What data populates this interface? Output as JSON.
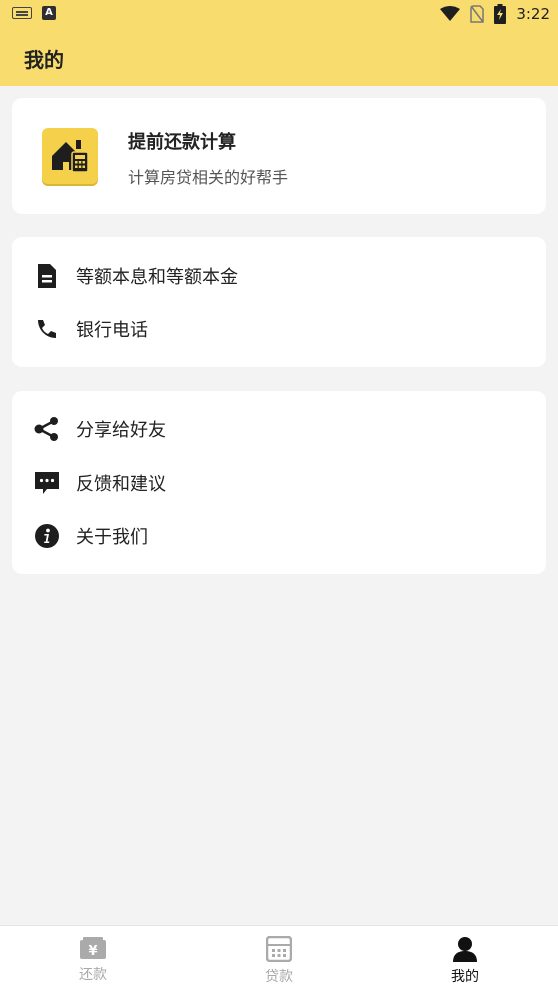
{
  "status_bar": {
    "time": "3:22"
  },
  "header": {
    "title": "我的"
  },
  "feature_card": {
    "title": "提前还款计算",
    "subtitle": "计算房贷相关的好帮手"
  },
  "group1": {
    "items": [
      {
        "label": "等额本息和等额本金",
        "icon": "document-icon"
      },
      {
        "label": "银行电话",
        "icon": "phone-icon"
      }
    ]
  },
  "group2": {
    "items": [
      {
        "label": "分享给好友",
        "icon": "share-icon"
      },
      {
        "label": "反馈和建议",
        "icon": "chat-icon"
      },
      {
        "label": "关于我们",
        "icon": "info-icon"
      }
    ]
  },
  "bottom_nav": {
    "items": [
      {
        "label": "还款",
        "icon": "yen-icon",
        "active": false
      },
      {
        "label": "贷款",
        "icon": "calculator-icon",
        "active": false
      },
      {
        "label": "我的",
        "icon": "user-icon",
        "active": true
      }
    ]
  },
  "colors": {
    "header_bg": "#f8dc6e",
    "page_bg": "#f3f3f3",
    "icon_bg": "#f5d04a"
  }
}
